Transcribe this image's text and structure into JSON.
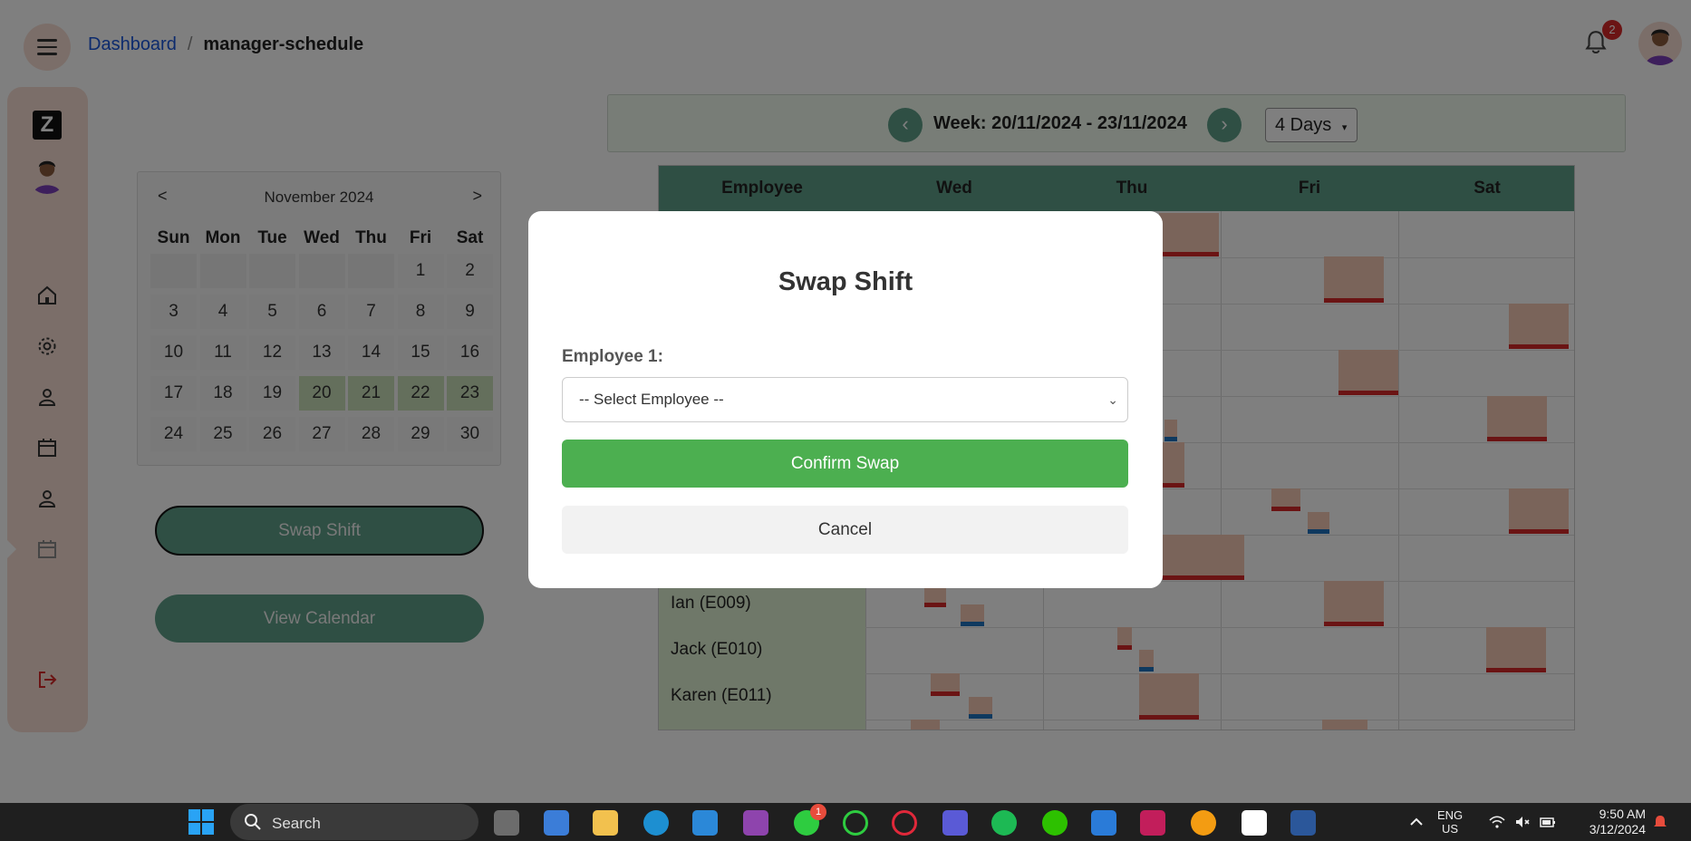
{
  "breadcrumb": {
    "root": "Dashboard",
    "separator": "/",
    "current": "manager-schedule"
  },
  "notifications": {
    "count": "2"
  },
  "calendar": {
    "prev": "<",
    "next": ">",
    "month_label": "November 2024",
    "weekdays": [
      "Sun",
      "Mon",
      "Tue",
      "Wed",
      "Thu",
      "Fri",
      "Sat"
    ],
    "weeks": [
      [
        "",
        "",
        "",
        "",
        "",
        "1",
        "2"
      ],
      [
        "3",
        "4",
        "5",
        "6",
        "7",
        "8",
        "9"
      ],
      [
        "10",
        "11",
        "12",
        "13",
        "14",
        "15",
        "16"
      ],
      [
        "17",
        "18",
        "19",
        "20",
        "21",
        "22",
        "23"
      ],
      [
        "24",
        "25",
        "26",
        "27",
        "28",
        "29",
        "30"
      ]
    ],
    "selected_days": [
      "20",
      "21",
      "22",
      "23"
    ]
  },
  "actions": {
    "swap_shift": "Swap Shift",
    "view_calendar": "View Calendar"
  },
  "week": {
    "prev": "‹",
    "next": "›",
    "label": "Week: 20/11/2024 - 23/11/2024",
    "range_option": "4 Days"
  },
  "schedule": {
    "headers": [
      "Employee",
      "Wed",
      "Thu",
      "Fri",
      "Sat"
    ],
    "employees": [
      "Ian (E009)",
      "Jack (E010)",
      "Karen (E011)"
    ]
  },
  "modal": {
    "title": "Swap Shift",
    "employee_label": "Employee 1:",
    "select_placeholder": "-- Select Employee --",
    "confirm": "Confirm Swap",
    "cancel": "Cancel"
  },
  "taskbar": {
    "search_label": "Search",
    "xbox_badge": "1",
    "lang_primary": "ENG",
    "lang_secondary": "US",
    "time": "9:50 AM",
    "date": "3/12/2024"
  },
  "colors": {
    "accent_green": "#5f9e88",
    "confirm_green": "#4caf50",
    "sidebar_peach": "#f6ddd2",
    "shift_red": "#d62828",
    "shift_blue": "#1e73be"
  }
}
